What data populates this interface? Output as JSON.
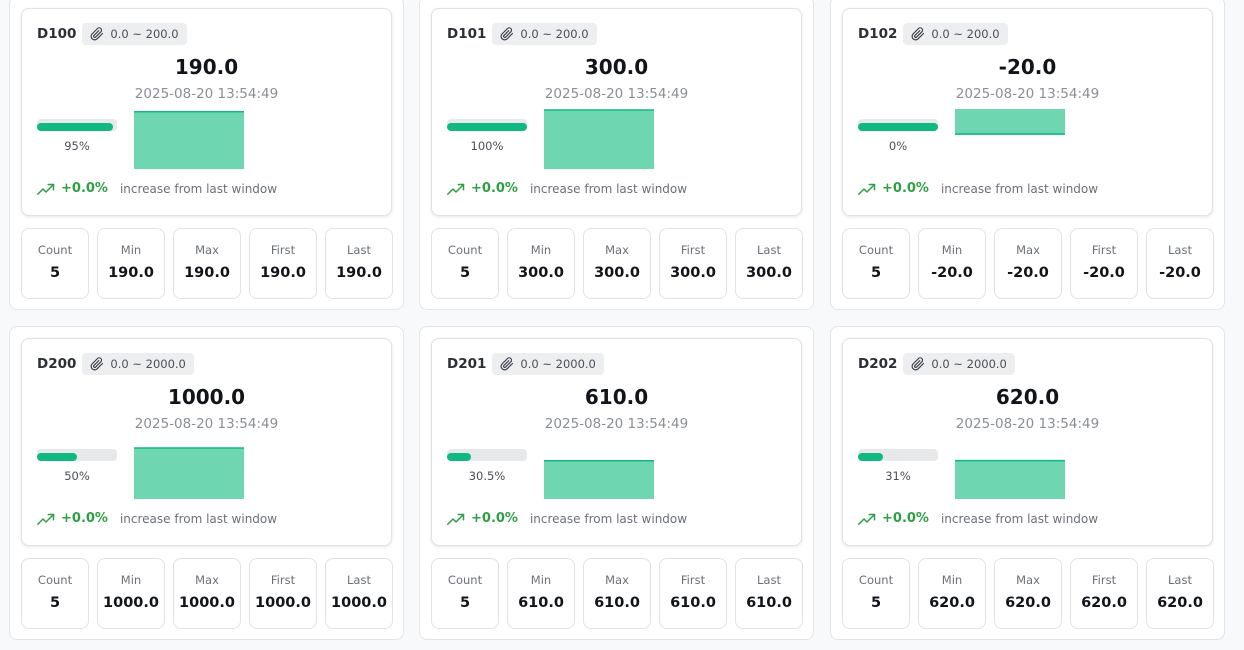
{
  "colors": {
    "accent": "#10b981",
    "spark_fill": "#6ed6b1",
    "trend": "#2f9e44"
  },
  "stat_labels": {
    "count": "Count",
    "min": "Min",
    "max": "Max",
    "first": "First",
    "last": "Last"
  },
  "trend_text": "increase from last window",
  "devices": [
    {
      "name": "D100",
      "range": "0.0 ~ 200.0",
      "value": "190.0",
      "timestamp": "2025-08-20 13:54:49",
      "progress": 0.95,
      "progress_label": "95%",
      "trend": "+0.0%",
      "count": "5",
      "min": "190.0",
      "max": "190.0",
      "first": "190.0",
      "last": "190.0"
    },
    {
      "name": "D101",
      "range": "0.0 ~ 200.0",
      "value": "300.0",
      "timestamp": "2025-08-20 13:54:49",
      "progress": 1.0,
      "progress_label": "100%",
      "trend": "+0.0%",
      "count": "5",
      "min": "300.0",
      "max": "300.0",
      "first": "300.0",
      "last": "300.0"
    },
    {
      "name": "D102",
      "range": "0.0 ~ 200.0",
      "value": "-20.0",
      "timestamp": "2025-08-20 13:54:49",
      "progress": 0.0,
      "progress_label": "0%",
      "trend": "+0.0%",
      "count": "5",
      "min": "-20.0",
      "max": "-20.0",
      "first": "-20.0",
      "last": "-20.0"
    },
    {
      "name": "D200",
      "range": "0.0 ~ 2000.0",
      "value": "1000.0",
      "timestamp": "2025-08-20 13:54:49",
      "progress": 0.5,
      "progress_label": "50%",
      "trend": "+0.0%",
      "count": "5",
      "min": "1000.0",
      "max": "1000.0",
      "first": "1000.0",
      "last": "1000.0"
    },
    {
      "name": "D201",
      "range": "0.0 ~ 2000.0",
      "value": "610.0",
      "timestamp": "2025-08-20 13:54:49",
      "progress": 0.305,
      "progress_label": "30.5%",
      "trend": "+0.0%",
      "count": "5",
      "min": "610.0",
      "max": "610.0",
      "first": "610.0",
      "last": "610.0"
    },
    {
      "name": "D202",
      "range": "0.0 ~ 2000.0",
      "value": "620.0",
      "timestamp": "2025-08-20 13:54:49",
      "progress": 0.31,
      "progress_label": "31%",
      "trend": "+0.0%",
      "count": "5",
      "min": "620.0",
      "max": "620.0",
      "first": "620.0",
      "last": "620.0"
    }
  ]
}
